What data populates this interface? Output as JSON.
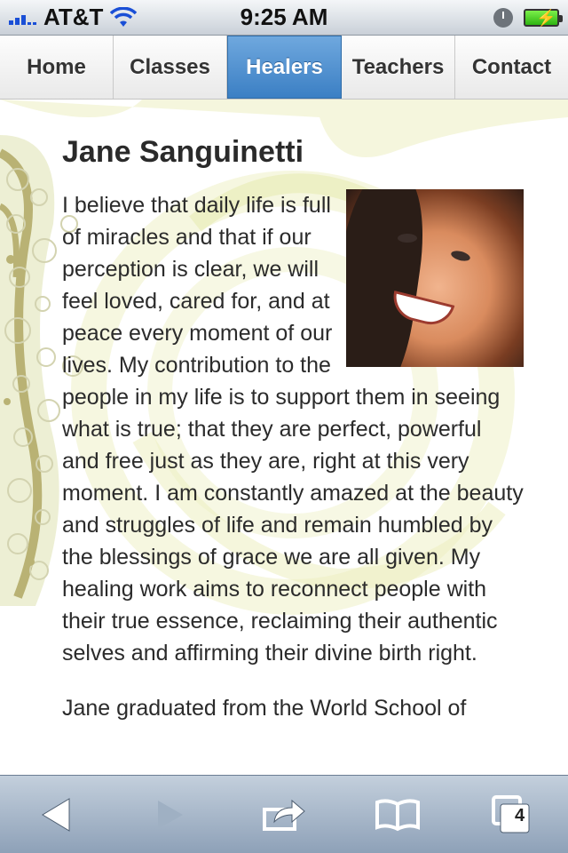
{
  "status_bar": {
    "carrier": "AT&T",
    "time": "9:25 AM"
  },
  "nav": {
    "tabs": [
      {
        "label": "Home",
        "active": false
      },
      {
        "label": "Classes",
        "active": false
      },
      {
        "label": "Healers",
        "active": true
      },
      {
        "label": "Teachers",
        "active": false
      },
      {
        "label": "Contact",
        "active": false
      }
    ]
  },
  "healer": {
    "name": "Jane Sanguinetti",
    "bio": "I believe that daily life is full of miracles and that if our perception is clear, we will feel loved, cared for, and at peace every moment of our lives. My contribution to the people in my life is to support them in seeing what is true; that they are perfect, powerful and free just as they are, right at this very moment. I am constantly amazed at the beauty and struggles of life and remain humbled by the blessings of grace we are all given. My healing work aims to reconnect people with their true essence, reclaiming their authentic selves and affirming their divine birth right.",
    "next_paragraph_partial": "Jane graduated from the World School of"
  },
  "toolbar": {
    "tabs_count": "4",
    "icons": [
      "back-icon",
      "forward-icon",
      "share-icon",
      "bookmarks-icon",
      "tabs-icon"
    ]
  },
  "colors": {
    "active_tab": "#3b7fc4",
    "toolbar": "#8ea1b8",
    "art_yellow": "#e8ebb3",
    "art_olive": "#b9b274"
  }
}
